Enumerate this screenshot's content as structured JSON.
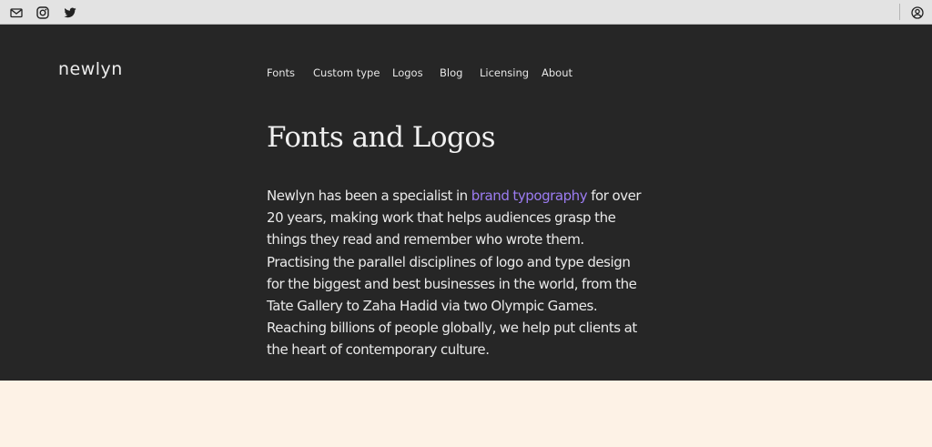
{
  "topbar": {
    "left_icons": [
      "mail-icon",
      "instagram-icon",
      "twitter-icon"
    ],
    "right_icons": [
      "account-icon"
    ]
  },
  "header": {
    "logo": "newlyn",
    "nav": [
      "Fonts",
      "Custom type",
      "Logos",
      "Blog",
      "Licensing",
      "About"
    ]
  },
  "main": {
    "title": "Fonts and Logos",
    "intro": {
      "line1_before": "Newlyn has been a specialist in ",
      "line1_link": "brand typography",
      "line1_after": " for over",
      "lines": [
        "20 years, making work that helps audiences grasp the",
        "things they read and remember who wrote them.",
        "Practising the parallel disciplines of logo and type design",
        "for the biggest and best businesses in the world, from the",
        "Tate Gallery to Zaha Hadid via two Olympic Games.",
        "Reaching billions of people globally, we help put clients at",
        "the heart of contemporary culture."
      ]
    }
  },
  "colors": {
    "topbar_bg": "#e3e3e3",
    "hero_bg": "#262626",
    "accent_link": "#9c7cf2",
    "page_bg": "#fdf2e6"
  }
}
